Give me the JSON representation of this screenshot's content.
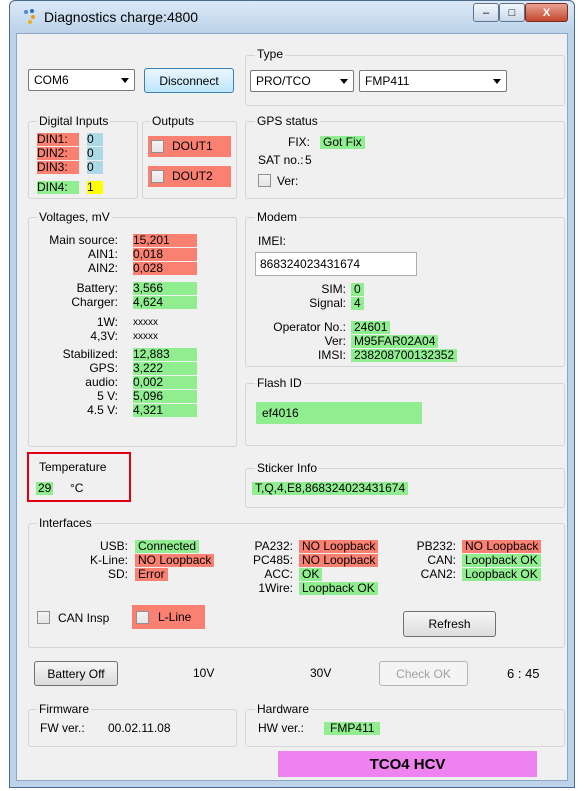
{
  "window": {
    "title": "Diagnostics charge:4800",
    "minimize": "–",
    "maximize": "□",
    "close": "X"
  },
  "connection": {
    "port": "COM6",
    "disconnect_label": "Disconnect"
  },
  "type": {
    "label": "Type",
    "mode": "PRO/TCO",
    "model": "FMP411"
  },
  "digital_inputs": {
    "label": "Digital Inputs",
    "items": [
      {
        "name": "DIN1:",
        "value": "0"
      },
      {
        "name": "DIN2:",
        "value": "0"
      },
      {
        "name": "DIN3:",
        "value": "0"
      },
      {
        "name": "DIN4:",
        "value": "1"
      }
    ]
  },
  "outputs": {
    "label": "Outputs",
    "dout1": "DOUT1",
    "dout2": "DOUT2"
  },
  "gps": {
    "label": "GPS status",
    "fix_label": "FIX:",
    "fix_value": "Got Fix",
    "sat_label": "SAT no.:",
    "sat_value": "5",
    "ver_label": "Ver:"
  },
  "voltages": {
    "label": "Voltages, mV",
    "rows": [
      {
        "name": "Main source:",
        "value": "15,201"
      },
      {
        "name": "AIN1:",
        "value": "0,018"
      },
      {
        "name": "AIN2:",
        "value": "0,028"
      },
      {
        "name": "Battery:",
        "value": "3,566"
      },
      {
        "name": "Charger:",
        "value": "4,624"
      },
      {
        "name": "1W:",
        "value": "xxxxx"
      },
      {
        "name": "4,3V:",
        "value": "xxxxx"
      },
      {
        "name": "Stabilized:",
        "value": "12,883"
      },
      {
        "name": "GPS:",
        "value": "3,222"
      },
      {
        "name": "audio:",
        "value": "0,002"
      },
      {
        "name": "5 V:",
        "value": "5,096"
      },
      {
        "name": "4.5 V:",
        "value": "4,321"
      }
    ]
  },
  "modem": {
    "label": "Modem",
    "imei_label": "IMEI:",
    "imei_value": "868324023431674",
    "sim_label": "SIM:",
    "sim_value": "0",
    "signal_label": "Signal:",
    "signal_value": "4",
    "operator_label": "Operator No.:",
    "operator_value": "24601",
    "ver_label": "Ver:",
    "ver_value": "M95FAR02A04",
    "imsi_label": "IMSI:",
    "imsi_value": "238208700132352"
  },
  "flash": {
    "label": "Flash ID",
    "value": "ef4016"
  },
  "temperature": {
    "label": "Temperature",
    "value": "29",
    "unit": "°C"
  },
  "sticker": {
    "label": "Sticker Info",
    "value": "T,Q,4,E8,868324023431674"
  },
  "interfaces": {
    "label": "Interfaces",
    "usb_label": "USB:",
    "usb_value": "Connected",
    "kline_label": "K-Line:",
    "kline_value": "NO Loopback",
    "sd_label": "SD:",
    "sd_value": "Error",
    "pa232_label": "PA232:",
    "pa232_value": "NO Loopback",
    "pc485_label": "PC485:",
    "pc485_value": "NO Loopback",
    "acc_label": "ACC:",
    "acc_value": "OK",
    "wire_label": "1Wire:",
    "wire_value": "Loopback OK",
    "pb232_label": "PB232:",
    "pb232_value": "NO Loopback",
    "can_label": "CAN:",
    "can_value": "Loopback OK",
    "can2_label": "CAN2:",
    "can2_value": "Loopback OK",
    "can_insp_label": "CAN Insp",
    "lline_label": "L-Line",
    "refresh_label": "Refresh"
  },
  "bottom": {
    "battery_off_label": "Battery Off",
    "v10": "10V",
    "v30": "30V",
    "check_ok_label": "Check OK",
    "timer": "6 : 45"
  },
  "firmware": {
    "label": "Firmware",
    "ver_label": "FW ver.:",
    "ver_value": "00.02.11.08"
  },
  "hardware": {
    "label": "Hardware",
    "ver_label": "HW ver.:",
    "ver_value": "FMP411"
  },
  "device_label": "TCO4 HCV",
  "colors": {
    "ok": "#90ee90",
    "error": "#fa8072",
    "high": "#ffff00",
    "low": "#add8e6",
    "device": "#ee82ee",
    "highlight": "#e0000f"
  }
}
